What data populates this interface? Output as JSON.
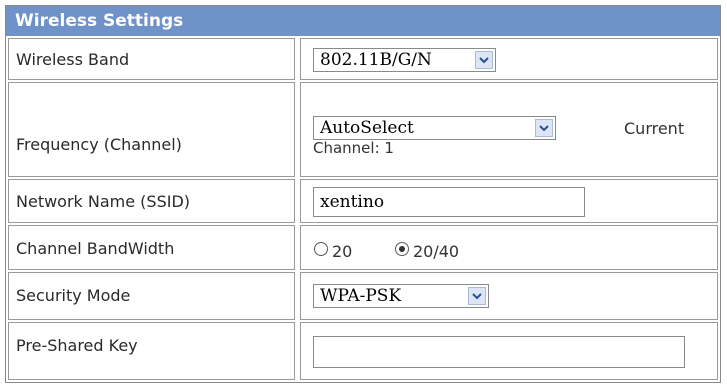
{
  "section": {
    "title": "Wireless Settings"
  },
  "rows": {
    "band": {
      "label": "Wireless Band",
      "value": "802.11B/G/N"
    },
    "frequency": {
      "label": "Frequency (Channel)",
      "value": "AutoSelect",
      "current_label": "Current",
      "channel_text": "Channel: 1"
    },
    "ssid": {
      "label": "Network Name (SSID)",
      "value": "xentino"
    },
    "bandwidth": {
      "label": "Channel BandWidth",
      "options": [
        "20",
        "20/40"
      ],
      "selected": "20/40"
    },
    "security": {
      "label": "Security Mode",
      "value": "WPA-PSK"
    },
    "psk": {
      "label": "Pre-Shared Key",
      "value": ""
    }
  },
  "colors": {
    "header_bg": "#6f92c8",
    "header_text": "#ffffff",
    "dropdown_arrow_bg": "#dde6f5"
  },
  "icons": {
    "dropdown": "chevron-down-icon",
    "radio": "radio-button-icon"
  }
}
